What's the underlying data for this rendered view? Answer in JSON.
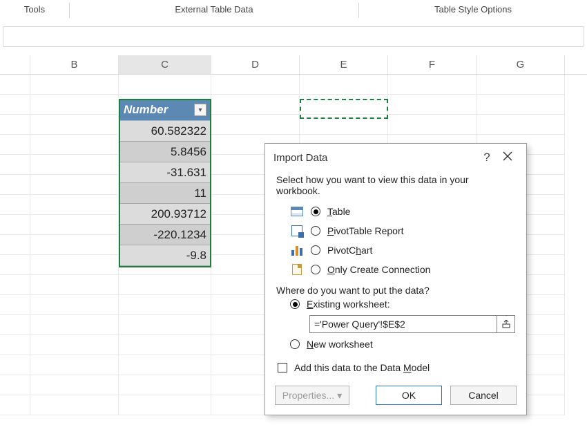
{
  "ribbon": {
    "group_tools": "Tools",
    "group_external": "External Table Data",
    "group_styles": "Table Style Options"
  },
  "columns": [
    "",
    "B",
    "C",
    "D",
    "E",
    "F",
    "G"
  ],
  "table": {
    "header": "Number",
    "values": [
      "60.582322",
      "5.8456",
      "-31.631",
      "11",
      "200.93712",
      "-220.1234",
      "-9.8"
    ]
  },
  "dialog": {
    "title": "Import Data",
    "help": "?",
    "prompt": "Select how you want to view this data in your workbook.",
    "opt_table": "able",
    "opt_table_pre": "T",
    "opt_pivot_pre": "P",
    "opt_pivot": "ivotTable Report",
    "opt_chart_pre": "PivotC",
    "opt_chart_mid": "h",
    "opt_chart_post": "art",
    "opt_conn_pre": "O",
    "opt_conn": "nly Create Connection",
    "where": "Where do you want to put the data?",
    "existing_pre": "E",
    "existing": "xisting worksheet:",
    "cell_ref": "='Power Query'!$E$2",
    "new_pre": "N",
    "new": "ew worksheet",
    "add_model_pre": "Add this data to the Data ",
    "add_model_u": "M",
    "add_model_post": "odel",
    "properties": "Properties...",
    "ok": "OK",
    "cancel": "Cancel"
  }
}
